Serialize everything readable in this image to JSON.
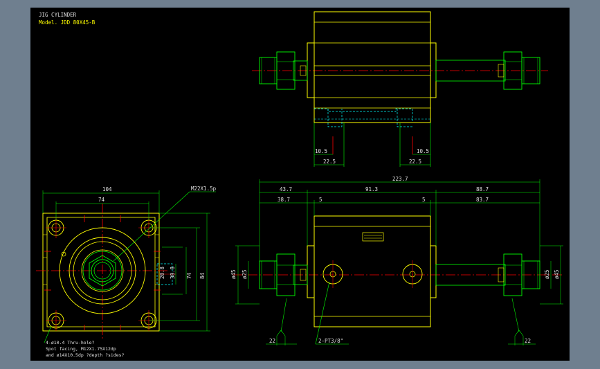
{
  "title_block": {
    "name": "JIG CYLINDER",
    "model": "Model. JDD 80X45-B"
  },
  "dimensions": {
    "top_view": {
      "left_offset": "10.5",
      "right_offset": "10.5",
      "left_width": "22.5",
      "right_width": "22.5"
    },
    "end_view": {
      "overall_width": "104",
      "hole_pitch": "74",
      "thread": "M22X1.5p",
      "port_depth": "20.8",
      "port_height": "38.8",
      "vertical_pitch": "74",
      "overall_height": "84",
      "hole_note_1": "4-ø10.4 Thru-hole?",
      "hole_note_2": "Spot facing, M12X1.75X12dp",
      "hole_note_3": "and ø14X10.5dp ?depth ?sides?"
    },
    "front_view": {
      "total_length": "223.7",
      "left_section": "43.7",
      "middle_section": "91.3",
      "right_section": "88.7",
      "left_rod": "38.7",
      "left_gap": "5",
      "right_gap": "5",
      "right_rod": "83.7",
      "left_rod_dia": "ø25",
      "left_body_dia": "ø45",
      "right_rod_dia": "ø25",
      "right_body_dia": "ø45",
      "left_wrench": "22",
      "right_wrench": "22",
      "port_note": "2-PT3/8\""
    }
  },
  "colors": {
    "background": "#000000",
    "frame": "#6f7f8f",
    "outline": "#ffff00",
    "dimension": "#00ff00",
    "center_line": "#ff0000",
    "hidden_line": "#00ffff",
    "text": "#e0e0e0"
  }
}
